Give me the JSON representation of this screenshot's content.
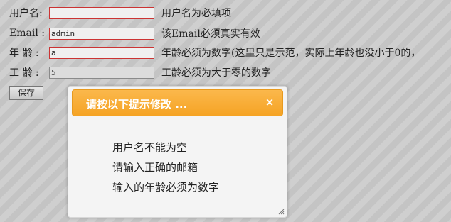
{
  "form": {
    "username": {
      "label": "用户名:",
      "value": "",
      "hint": "用户名为必填项"
    },
    "email": {
      "label": "Email :",
      "value": "admin",
      "hint": "该Email必须真实有效"
    },
    "age": {
      "label": "年 龄 :",
      "value": "a",
      "hint": "年龄必须为数字(这里只是示范，实际上年龄也没小于0的，"
    },
    "work_age": {
      "label": "工 龄 :",
      "value": "5",
      "hint": "工龄必须为大于零的数字"
    },
    "save_label": "保存"
  },
  "dialog": {
    "title": "请按以下提示修改 ...",
    "close_glyph": "×",
    "messages": [
      "用户名不能为空",
      "请输入正确的邮箱",
      "输入的年龄必须为数字"
    ]
  },
  "colors": {
    "error_border": "#cc3333",
    "header_orange": "#f5a324"
  },
  "icons": {
    "close": "close-icon",
    "resize": "resize-grip-icon"
  }
}
